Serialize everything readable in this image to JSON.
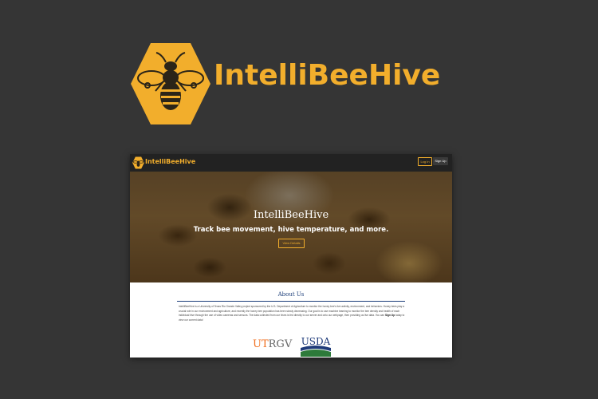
{
  "brand": {
    "name": "IntelliBeeHive",
    "accent": "#F2AE2C",
    "icon": "bee-hexagon-logo"
  },
  "screenshot": {
    "nav": {
      "site_name": "IntelliBeeHive",
      "login_label": "Log In",
      "signup_label": "Sign Up"
    },
    "hero": {
      "title": "IntelliBeeHive",
      "subtitle": "Track bee movement, hive temperature, and more.",
      "button_label": "View Details"
    },
    "about": {
      "title": "About Us",
      "text_before": "IntelliBeeHive is a University of Texas Rio Grande Valley project sponsored by the U.S. Department of Agriculture to monitor the honey bee's live activity, environment, and behaviors. Honey bees play a crucial role in our environment and agriculture, and recently the honey bee population has been slowly decreasing. Our goal is to use machine learning to monitor the bee density and health of each individual hive through the use of video cameras and sensors. The data collected from our hives is fed directly to our server and onto our webpage, then providing us live data. You can ",
      "signup_link": "Sign Up",
      "text_after": " today to view our current data!"
    },
    "logos": {
      "utrgv_ut": "UT",
      "utrgv_rgv": "RGV",
      "usda": "USDA"
    }
  }
}
